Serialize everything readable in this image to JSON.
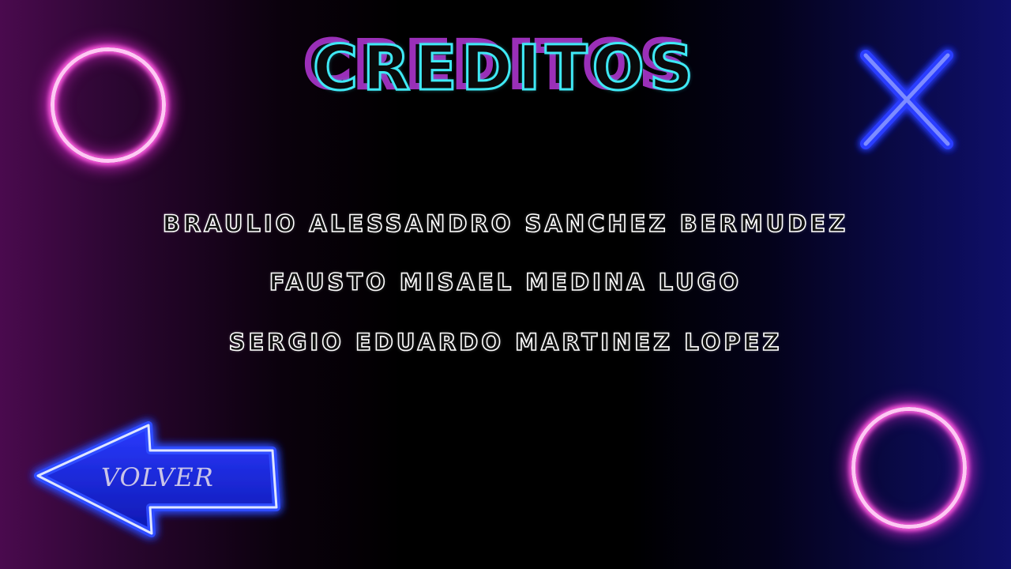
{
  "screen": {
    "title": "CREDITOS",
    "names": [
      "BRAULIO ALESSANDRO SANCHEZ BERMUDEZ",
      "FAUSTO MISAEL MEDINA LUGO",
      "SERGIO EDUARDO MARTINEZ LOPEZ"
    ],
    "back_button": {
      "label": "VOLVER",
      "icon": "left-arrow-icon"
    },
    "decorations": {
      "circle_icon": "neon-circle-icon",
      "x_icon": "neon-x-icon"
    }
  },
  "colors": {
    "title_outline": "#3fe9f5",
    "title_shadow": "#9a2fb8",
    "circle_neon": "#ff5fe0",
    "x_neon": "#3a4dff",
    "button_fill": "#1526d8",
    "name_outline": "#ffffff"
  }
}
